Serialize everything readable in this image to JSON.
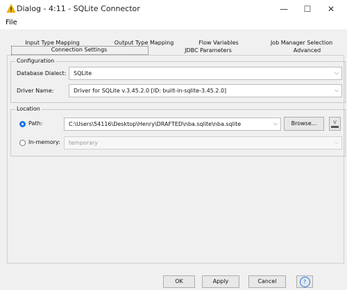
{
  "window": {
    "title": "Dialog - 4:11 - SQLite Connector",
    "minimize_glyph": "—",
    "maximize_glyph": "☐",
    "close_glyph": "✕"
  },
  "menu": {
    "file": "File"
  },
  "tabs": {
    "row1": [
      "Input Type Mapping",
      "Output Type Mapping",
      "Flow Variables",
      "Job Manager Selection"
    ],
    "row2": [
      "Connection Settings",
      "JDBC Parameters",
      "Advanced"
    ],
    "active": "Connection Settings"
  },
  "configuration": {
    "group_label": "Configuration",
    "dialect_label": "Database Dialect:",
    "dialect_value": "SQLite",
    "driver_label": "Driver Name:",
    "driver_value": "Driver for SQLite v.3.45.2.0 [ID: built-in-sqlite-3.45.2.0]"
  },
  "location": {
    "group_label": "Location",
    "path_label": "Path:",
    "path_value": "C:\\Users\\54116\\Desktop\\Henry\\DRAFTED\\nba.sqlite\\nba.sqlite",
    "browse_label": "Browse...",
    "inmemory_label": "In-memory:",
    "inmemory_value": "temporary",
    "selected": "path"
  },
  "footer": {
    "ok": "OK",
    "apply": "Apply",
    "cancel": "Cancel",
    "help_glyph": "?"
  },
  "colors": {
    "accent": "#1a73e8",
    "warning": "#f5b400"
  },
  "icons": [
    "warning-icon",
    "minimize-icon",
    "maximize-icon",
    "close-icon",
    "chevron-down-icon",
    "flow-variable-icon",
    "help-icon"
  ]
}
